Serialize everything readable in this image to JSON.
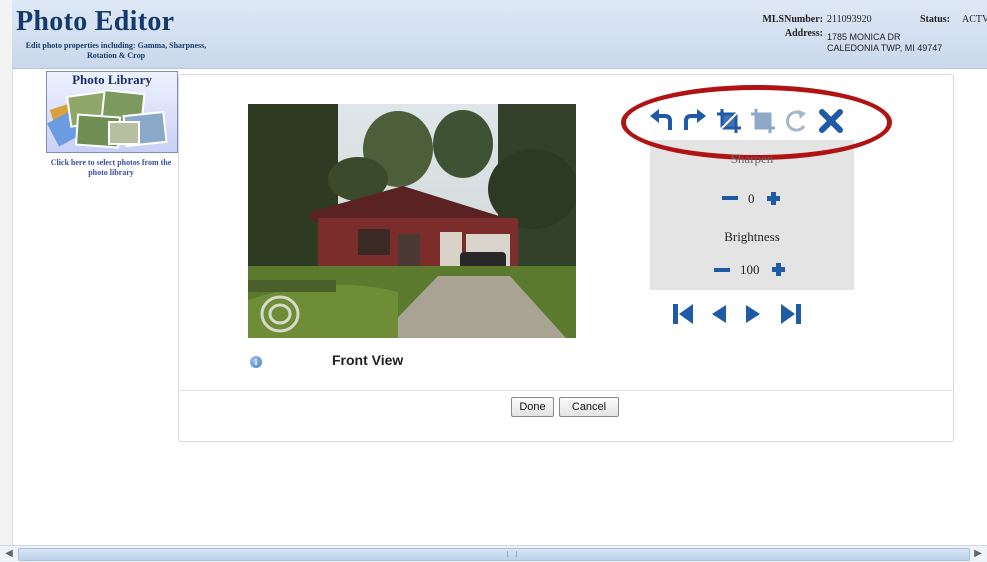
{
  "header": {
    "title": "Photo Editor",
    "subtitle": "Edit photo properties including: Gamma, Sharpness, Rotation & Crop",
    "mls_label": "MLSNumber:",
    "mls_value": "211093920",
    "status_label": "Status:",
    "status_value": "ACTV",
    "address_label": "Address:",
    "address_line1": "1785 MONICA DR",
    "address_line2": "CALEDONIA TWP, MI 49747"
  },
  "library": {
    "title": "Photo Library",
    "link_text": "Click here to select photos from the photo library"
  },
  "photo": {
    "caption": "Front View",
    "info_glyph": "i"
  },
  "toolbar": {
    "icons": [
      "rotate-left-icon",
      "rotate-right-icon",
      "crop-icon",
      "crop-disabled-icon",
      "reset-disabled-icon",
      "delete-icon"
    ],
    "highlight_color": "#b01313"
  },
  "controls": {
    "sharpen_label": "Sharpen",
    "sharpen_value": "0",
    "brightness_label": "Brightness",
    "brightness_value": "100"
  },
  "footer": {
    "done_label": "Done",
    "cancel_label": "Cancel"
  },
  "colors": {
    "accent": "#1f5aa6",
    "title": "#143a6b",
    "header_bg": "#d3e0f1",
    "panel_bg": "#e4e4e4"
  }
}
